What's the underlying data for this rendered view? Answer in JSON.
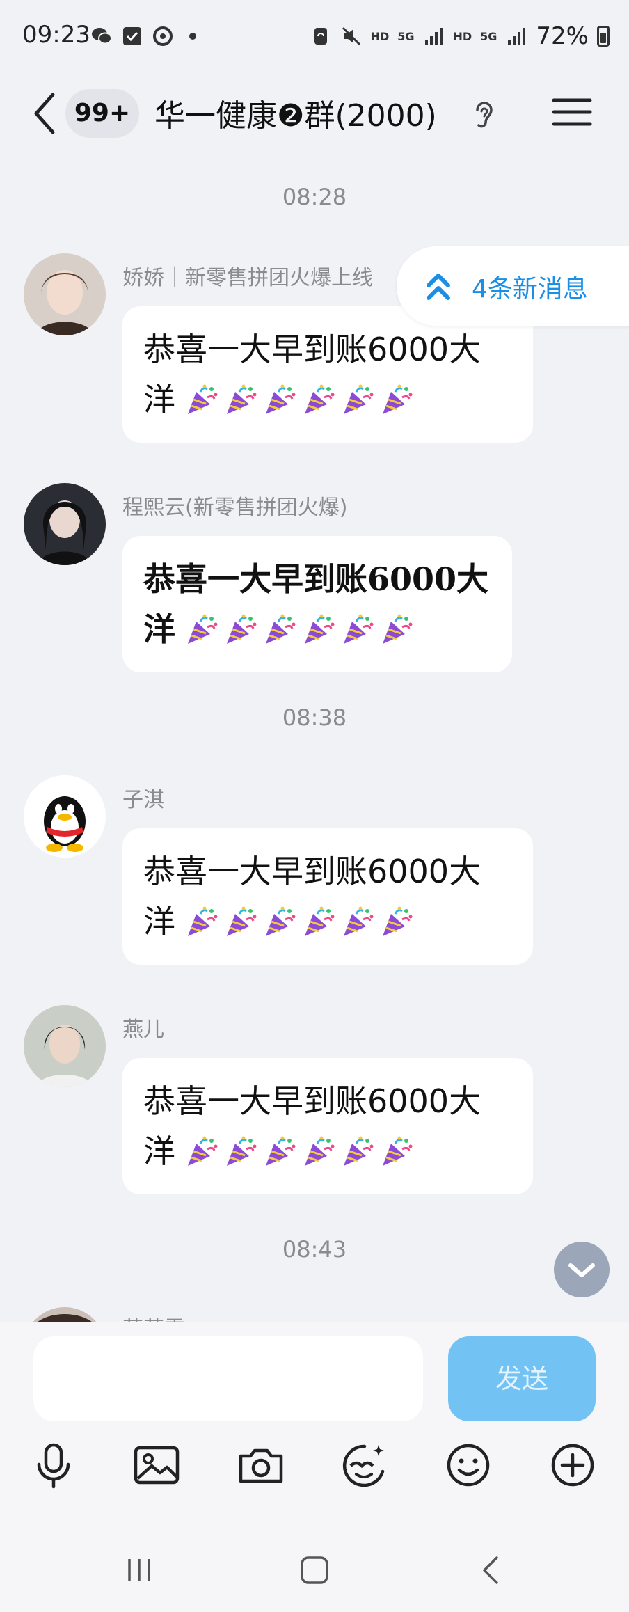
{
  "status_bar": {
    "time": "09:23",
    "battery": "72%",
    "net_hd_1": "HD",
    "net_5g_1": "5G",
    "net_hd_2": "HD",
    "net_5g_2": "5G"
  },
  "header": {
    "unread_count": "99+",
    "title": "华一健康❷群(2000)"
  },
  "new_messages_pill": {
    "label": "4条新消息"
  },
  "time_separators": [
    "08:28",
    "08:38",
    "08:43"
  ],
  "messages": [
    {
      "sender": "娇娇｜新零售拼团火爆上线",
      "text": "恭喜一大早到账6000大",
      "text2": "洋"
    },
    {
      "sender": "程熙云(新零售拼团火爆)",
      "text": "恭喜一大早到账6000大",
      "text2": "洋"
    },
    {
      "sender": "子淇",
      "text": "恭喜一大早到账6000大",
      "text2": "洋"
    },
    {
      "sender": "燕儿",
      "text": "恭喜一大早到账6000大",
      "text2": "洋"
    },
    {
      "sender": "莎莎雪"
    }
  ],
  "input": {
    "send_label": "发送",
    "placeholder": ""
  },
  "colors": {
    "accent": "#1b8fe6",
    "send_button": "#72c3f4",
    "background": "#f1f2f6"
  },
  "icons": [
    "back-icon",
    "ear-icon",
    "menu-icon",
    "party-popper-icon",
    "scroll-down-icon",
    "mic-icon",
    "image-icon",
    "camera-icon",
    "sticker-icon",
    "emoji-icon",
    "plus-icon"
  ]
}
